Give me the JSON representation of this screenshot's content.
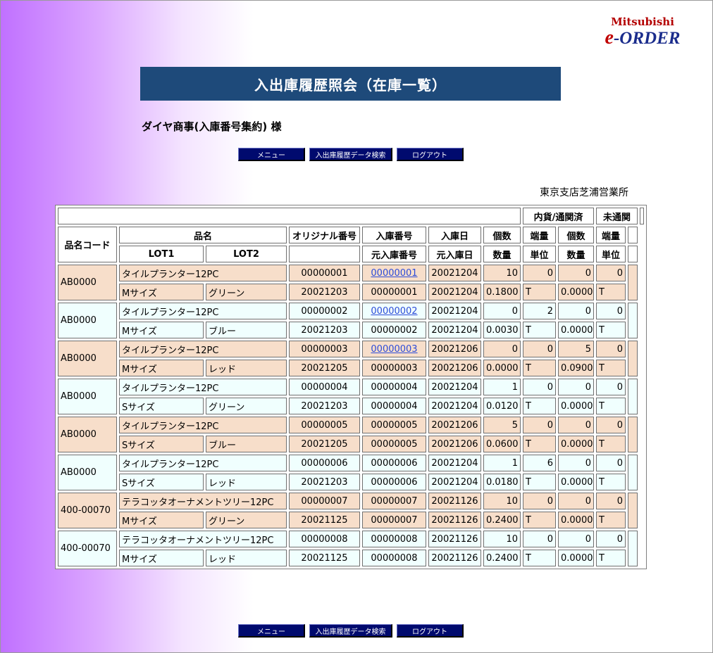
{
  "logo": {
    "brand": "Mitsubishi",
    "e": "e",
    "order": "-ORDER"
  },
  "page_title": "入出庫履歴照会（在庫一覧）",
  "customer": "ダイヤ商事(入庫番号集約) 様",
  "buttons": {
    "menu": "メニュー",
    "search": "入出庫履歴データ検索",
    "logout": "ログアウト"
  },
  "office": "東京支店芝浦営業所",
  "headers": {
    "domestic": "内貨/通関済",
    "uncleared": "未通関",
    "code": "品名コード",
    "name": "品名",
    "original_no": "オリジナル番号",
    "receipt_no": "入庫番号",
    "receipt_date": "入庫日",
    "count": "個数",
    "fraction": "端量",
    "lot1": "LOT1",
    "lot2": "LOT2",
    "orig_receipt_no": "元入庫番号",
    "orig_receipt_date": "元入庫日",
    "quantity": "数量",
    "unit": "単位"
  },
  "rows": [
    {
      "code": "AB0000",
      "name": "タイルプランター12PC",
      "original": "00000001",
      "receipt": "00000001",
      "receipt_link": true,
      "date": "20021204",
      "dom_count": "10",
      "dom_frac": "0",
      "unc_count": "0",
      "unc_frac": "0",
      "lot1": "Mサイズ",
      "lot2": "グリーン",
      "lot_date": "20021203",
      "orig_receipt": "00000001",
      "orig_date": "20021204",
      "dom_qty": "0.1800",
      "dom_unit": "T",
      "unc_qty": "0.0000",
      "unc_unit": "T"
    },
    {
      "code": "AB0000",
      "name": "タイルプランター12PC",
      "original": "00000002",
      "receipt": "00000002",
      "receipt_link": true,
      "date": "20021204",
      "dom_count": "0",
      "dom_frac": "2",
      "unc_count": "0",
      "unc_frac": "0",
      "lot1": "Mサイズ",
      "lot2": "ブルー",
      "lot_date": "20021203",
      "orig_receipt": "00000002",
      "orig_date": "20021204",
      "dom_qty": "0.0030",
      "dom_unit": "T",
      "unc_qty": "0.0000",
      "unc_unit": "T"
    },
    {
      "code": "AB0000",
      "name": "タイルプランター12PC",
      "original": "00000003",
      "receipt": "00000003",
      "receipt_link": true,
      "date": "20021206",
      "dom_count": "0",
      "dom_frac": "0",
      "unc_count": "5",
      "unc_frac": "0",
      "lot1": "Mサイズ",
      "lot2": "レッド",
      "lot_date": "20021205",
      "orig_receipt": "00000003",
      "orig_date": "20021206",
      "dom_qty": "0.0000",
      "dom_unit": "T",
      "unc_qty": "0.0900",
      "unc_unit": "T"
    },
    {
      "code": "AB0000",
      "name": "タイルプランター12PC",
      "original": "00000004",
      "receipt": "00000004",
      "receipt_link": false,
      "date": "20021204",
      "dom_count": "1",
      "dom_frac": "0",
      "unc_count": "0",
      "unc_frac": "0",
      "lot1": "Sサイズ",
      "lot2": "グリーン",
      "lot_date": "20021203",
      "orig_receipt": "00000004",
      "orig_date": "20021204",
      "dom_qty": "0.0120",
      "dom_unit": "T",
      "unc_qty": "0.0000",
      "unc_unit": "T"
    },
    {
      "code": "AB0000",
      "name": "タイルプランター12PC",
      "original": "00000005",
      "receipt": "00000005",
      "receipt_link": false,
      "date": "20021206",
      "dom_count": "5",
      "dom_frac": "0",
      "unc_count": "0",
      "unc_frac": "0",
      "lot1": "Sサイズ",
      "lot2": "ブルー",
      "lot_date": "20021205",
      "orig_receipt": "00000005",
      "orig_date": "20021206",
      "dom_qty": "0.0600",
      "dom_unit": "T",
      "unc_qty": "0.0000",
      "unc_unit": "T"
    },
    {
      "code": "AB0000",
      "name": "タイルプランター12PC",
      "original": "00000006",
      "receipt": "00000006",
      "receipt_link": false,
      "date": "20021204",
      "dom_count": "1",
      "dom_frac": "6",
      "unc_count": "0",
      "unc_frac": "0",
      "lot1": "Sサイズ",
      "lot2": "レッド",
      "lot_date": "20021203",
      "orig_receipt": "00000006",
      "orig_date": "20021204",
      "dom_qty": "0.0180",
      "dom_unit": "T",
      "unc_qty": "0.0000",
      "unc_unit": "T"
    },
    {
      "code": "400-00070",
      "name": "テラコッタオーナメントツリー12PC",
      "original": "00000007",
      "receipt": "00000007",
      "receipt_link": false,
      "date": "20021126",
      "dom_count": "10",
      "dom_frac": "0",
      "unc_count": "0",
      "unc_frac": "0",
      "lot1": "Mサイズ",
      "lot2": "グリーン",
      "lot_date": "20021125",
      "orig_receipt": "00000007",
      "orig_date": "20021126",
      "dom_qty": "0.2400",
      "dom_unit": "T",
      "unc_qty": "0.0000",
      "unc_unit": "T"
    },
    {
      "code": "400-00070",
      "name": "テラコッタオーナメントツリー12PC",
      "original": "00000008",
      "receipt": "00000008",
      "receipt_link": false,
      "date": "20021126",
      "dom_count": "10",
      "dom_frac": "0",
      "unc_count": "0",
      "unc_frac": "0",
      "lot1": "Mサイズ",
      "lot2": "レッド",
      "lot_date": "20021125",
      "orig_receipt": "00000008",
      "orig_date": "20021126",
      "dom_qty": "0.2400",
      "dom_unit": "T",
      "unc_qty": "0.0000",
      "unc_unit": "T"
    }
  ]
}
